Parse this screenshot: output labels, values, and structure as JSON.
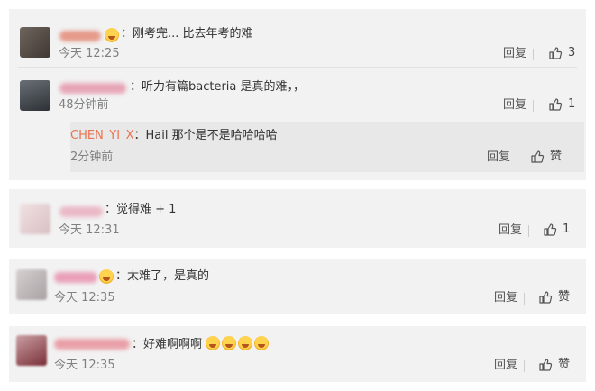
{
  "comments": [
    {
      "text": "：刚考完... 比去年考的难",
      "time": "今天 12:25",
      "reply_label": "回复",
      "likes": "3",
      "colors": {
        "avatar": "#5b5048",
        "name": "#e59a8a"
      }
    },
    {
      "text": "：听力有篇bacteria 是真的难，，",
      "time": "48分钟前",
      "reply_label": "回复",
      "likes": "1",
      "colors": {
        "avatar": "#4a4f55",
        "name": "#e7a6b8"
      },
      "subreply": {
        "user": "CHEN_YI_X",
        "text": "：Hail 那个是不是哈哈哈哈",
        "time": "2分钟前",
        "reply_label": "回复",
        "likes": "赞"
      }
    },
    {
      "text": "：觉得难 + 1",
      "time": "今天 12:31",
      "reply_label": "回复",
      "likes": "1",
      "colors": {
        "avatar": "#e6cfd2",
        "name": "#eab9c6"
      }
    },
    {
      "text": "：太难了，是真的",
      "time": "今天 12:35",
      "reply_label": "回复",
      "likes": "赞",
      "colors": {
        "avatar": "#c9c2c3",
        "name": "#e99fb8"
      }
    },
    {
      "text": "：好难啊啊啊",
      "time": "今天 12:35",
      "reply_label": "回复",
      "likes": "赞",
      "colors": {
        "avatar": "#8a3942",
        "name": "#e9a0a8"
      }
    }
  ],
  "colors": {
    "card_bg": "#f2f2f2",
    "subreply_bg": "#e8e8e8",
    "link": "#eb7350",
    "time": "#808080"
  },
  "icons": {
    "like": "thumbs-up-icon",
    "emoji": "laughing-crying-emoji"
  }
}
